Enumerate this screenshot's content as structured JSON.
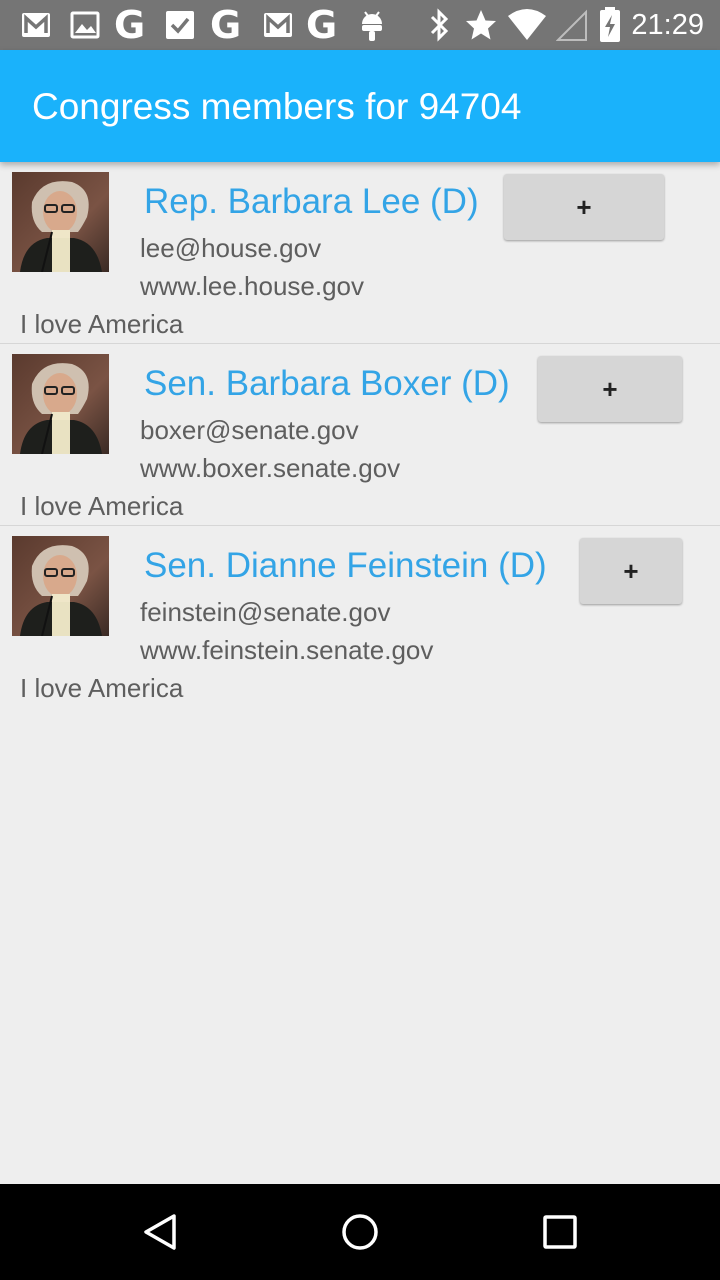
{
  "status_bar": {
    "time": "21:29",
    "left_icons": [
      "gmail-icon",
      "image-icon",
      "google-icon",
      "checkbox-icon",
      "google-icon",
      "gmail-icon",
      "google-icon",
      "android-icon"
    ],
    "google_glyph": "G",
    "right_icons": [
      "bluetooth-icon",
      "star-icon",
      "wifi-icon",
      "signal-icon",
      "battery-charging-icon"
    ]
  },
  "app_bar": {
    "title": "Congress members for 94704",
    "color": "#1ab2fb"
  },
  "members": [
    {
      "name": "Rep. Barbara Lee (D)",
      "email": "lee@house.gov",
      "website": "www.lee.house.gov",
      "motto": "I love America",
      "button_label": "+"
    },
    {
      "name": "Sen. Barbara Boxer (D)",
      "email": "boxer@senate.gov",
      "website": "www.boxer.senate.gov",
      "motto": "I love America",
      "button_label": "+"
    },
    {
      "name": "Sen. Dianne Feinstein (D)",
      "email": "feinstein@senate.gov",
      "website": "www.feinstein.senate.gov",
      "motto": "I love America",
      "button_label": "+"
    }
  ],
  "nav_bar": {
    "icons": [
      "back-icon",
      "home-icon",
      "recents-icon"
    ]
  },
  "colors": {
    "accent": "#33a4e6",
    "background": "#eeeeee",
    "button": "#d6d6d6"
  }
}
